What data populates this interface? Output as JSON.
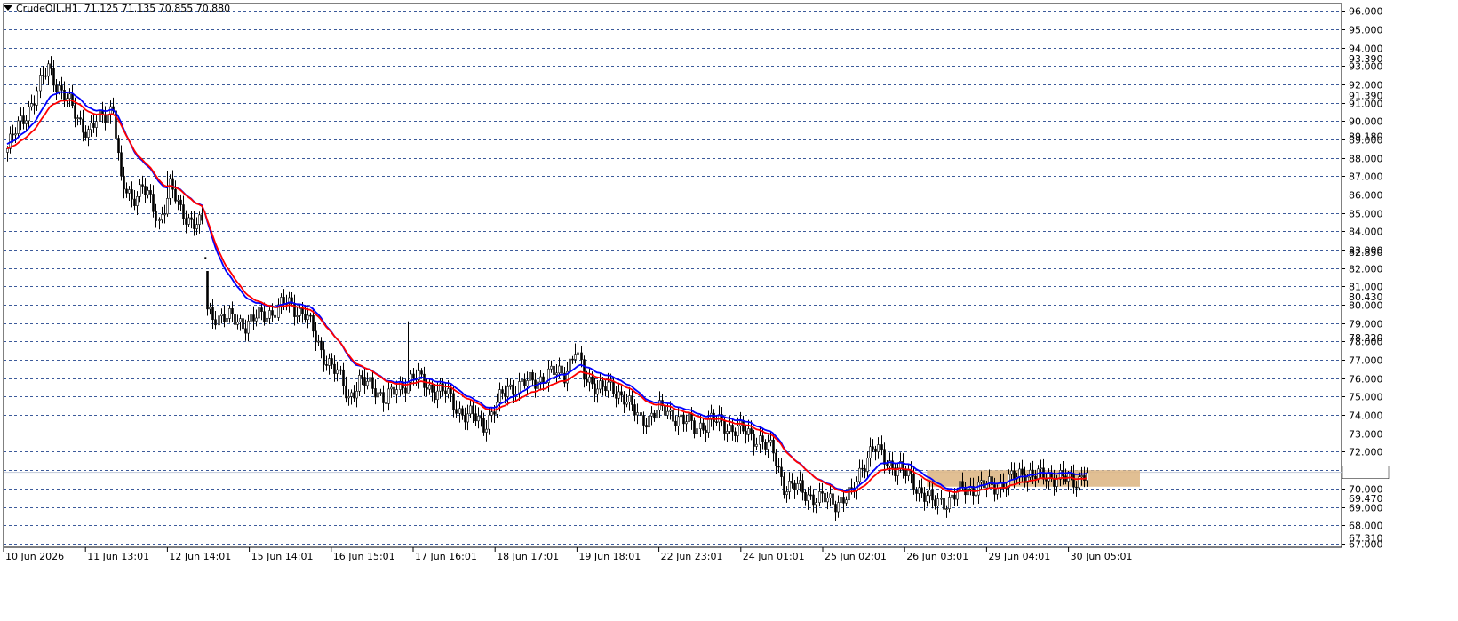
{
  "header": {
    "symbol": "CrudeOIL,H1",
    "ohlc": "71.125 71.135 70.855 70.880"
  },
  "colors": {
    "background": "#ffffff",
    "grid": "#3c5a9a",
    "candle": "#000000",
    "ma_fast": "#0000ff",
    "ma_slow": "#ff0000",
    "zone": "#deb887",
    "bid_line": "#c0c8d8"
  },
  "chart_data": {
    "type": "candlestick",
    "ylim": [
      66.8,
      96.4
    ],
    "y_ticks": [
      "96.000",
      "95.000",
      "94.000",
      "93.000",
      "92.000",
      "91.000",
      "90.000",
      "89.000",
      "88.000",
      "87.000",
      "86.000",
      "85.000",
      "84.000",
      "83.000",
      "82.000",
      "81.000",
      "80.000",
      "79.000",
      "78.000",
      "77.000",
      "76.000",
      "75.000",
      "74.000",
      "73.000",
      "72.000",
      "71.000",
      "70.000",
      "69.000",
      "68.000",
      "67.000"
    ],
    "y_extra_labels": [
      "93.390",
      "91.390",
      "89.180",
      "82.850",
      "80.430",
      "78.220",
      "69.470",
      "67.310"
    ],
    "x_labels": [
      "10 Jun 2026",
      "11 Jun 13:01",
      "12 Jun 14:01",
      "15 Jun 14:01",
      "16 Jun 15:01",
      "17 Jun 16:01",
      "18 Jun 17:01",
      "19 Jun 18:01",
      "22 Jun 23:01",
      "24 Jun 01:01",
      "25 Jun 02:01",
      "26 Jun 03:01",
      "29 Jun 04:01",
      "30 Jun 05:01"
    ],
    "current_price": 70.88,
    "zone": {
      "y1": 70.1,
      "y2": 71.0
    },
    "price_anchors": [
      [
        0,
        88.5
      ],
      [
        5,
        90.0
      ],
      [
        10,
        91.2
      ],
      [
        15,
        93.0
      ],
      [
        20,
        91.5
      ],
      [
        25,
        90.5
      ],
      [
        30,
        89.3
      ],
      [
        35,
        90.3
      ],
      [
        39,
        90.8
      ],
      [
        42,
        86.5
      ],
      [
        46,
        85.8
      ],
      [
        50,
        86.5
      ],
      [
        56,
        84.5
      ],
      [
        60,
        86.5
      ],
      [
        64,
        85.0
      ],
      [
        72,
        84.3
      ],
      [
        74,
        79.6
      ],
      [
        80,
        79.3
      ],
      [
        88,
        79.0
      ],
      [
        96,
        79.5
      ],
      [
        103,
        80.1
      ],
      [
        110,
        79.5
      ],
      [
        116,
        77.5
      ],
      [
        122,
        76.2
      ],
      [
        126,
        75.0
      ],
      [
        130,
        75.8
      ],
      [
        136,
        75.5
      ],
      [
        140,
        74.8
      ],
      [
        147,
        75.8
      ],
      [
        150,
        76.1
      ],
      [
        156,
        75.5
      ],
      [
        162,
        75.2
      ],
      [
        168,
        74.1
      ],
      [
        172,
        73.9
      ],
      [
        176,
        73.5
      ],
      [
        180,
        74.3
      ],
      [
        185,
        75.5
      ],
      [
        194,
        75.8
      ],
      [
        200,
        76.2
      ],
      [
        206,
        76.3
      ],
      [
        210,
        77.5
      ],
      [
        213,
        76.0
      ],
      [
        220,
        75.5
      ],
      [
        228,
        75.1
      ],
      [
        234,
        73.6
      ],
      [
        240,
        74.3
      ],
      [
        248,
        73.9
      ],
      [
        254,
        73.3
      ],
      [
        260,
        73.7
      ],
      [
        270,
        73.2
      ],
      [
        278,
        72.7
      ],
      [
        283,
        71.9
      ],
      [
        287,
        70.2
      ],
      [
        292,
        70.0
      ],
      [
        300,
        69.4
      ],
      [
        306,
        69.3
      ],
      [
        312,
        69.6
      ],
      [
        316,
        71.3
      ],
      [
        320,
        72.2
      ],
      [
        324,
        71.6
      ],
      [
        330,
        71.0
      ],
      [
        334,
        70.5
      ],
      [
        338,
        69.8
      ],
      [
        342,
        69.2
      ],
      [
        348,
        69.4
      ],
      [
        354,
        70.0
      ],
      [
        360,
        70.1
      ],
      [
        366,
        70.2
      ],
      [
        370,
        70.4
      ],
      [
        376,
        70.9
      ],
      [
        382,
        70.6
      ],
      [
        388,
        70.7
      ],
      [
        394,
        70.3
      ],
      [
        398,
        70.9
      ],
      [
        400,
        71.0
      ]
    ],
    "special_bars": {
      "74": {
        "h": 80.2,
        "l": 79.4
      },
      "148": {
        "h": 79.1,
        "l": 75.5
      },
      "59": {
        "h": 87.3,
        "l": 84.8
      },
      "210": {
        "h": 77.9,
        "l": 76.8
      }
    },
    "lone_dot": {
      "bar": 73,
      "value": 82.6
    },
    "total_bars": 400
  }
}
